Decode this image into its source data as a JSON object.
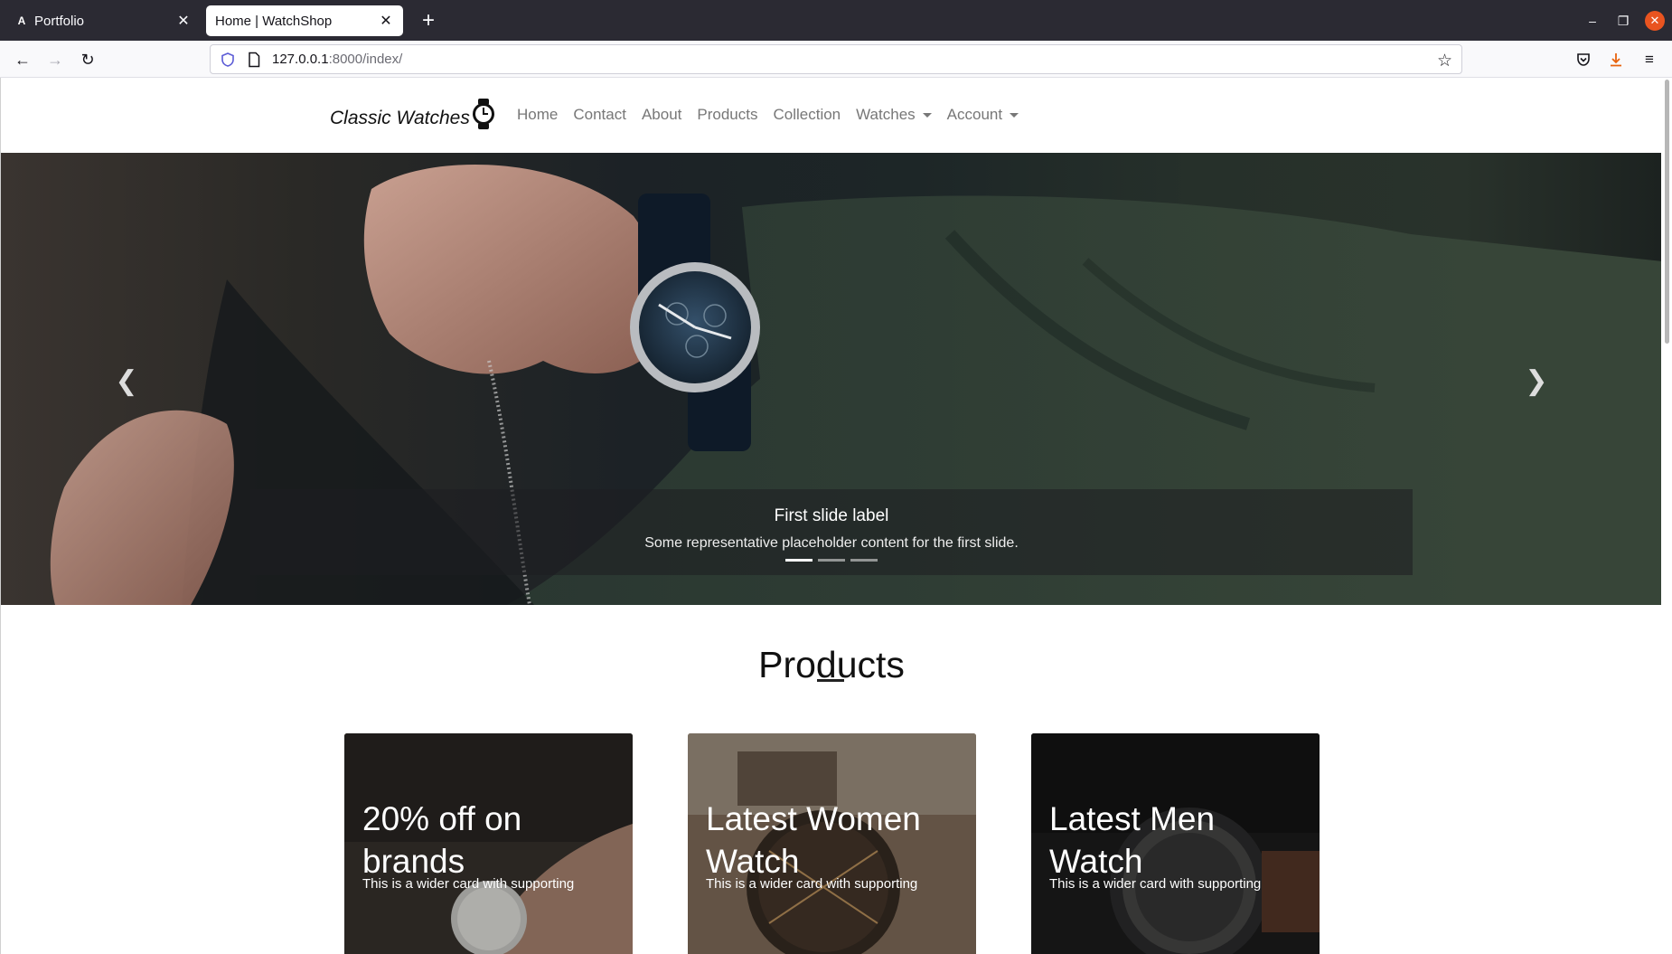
{
  "browser": {
    "tabs": [
      {
        "title": "Portfolio",
        "favicon": "A",
        "active": false
      },
      {
        "title": "Home | WatchShop",
        "active": true
      }
    ],
    "url_host": "127.0.0.1",
    "url_path": ":8000/index/"
  },
  "site": {
    "brand": "Classic Watches",
    "menu": [
      {
        "label": "Home",
        "dropdown": false
      },
      {
        "label": "Contact",
        "dropdown": false
      },
      {
        "label": "About",
        "dropdown": false
      },
      {
        "label": "Products",
        "dropdown": false
      },
      {
        "label": "Collection",
        "dropdown": false
      },
      {
        "label": "Watches",
        "dropdown": true
      },
      {
        "label": "Account",
        "dropdown": true
      }
    ]
  },
  "carousel": {
    "slide_title": "First slide label",
    "slide_text": "Some representative placeholder content for the first slide.",
    "slide_count": 3,
    "active_index": 0
  },
  "products": {
    "heading": "Products",
    "cards": [
      {
        "title": "20% off on brands",
        "text": "This is a wider card with supporting"
      },
      {
        "title": "Latest Women Watch",
        "text": "This is a wider card with supporting"
      },
      {
        "title": "Latest Men Watch",
        "text": "This is a wider card with supporting"
      }
    ]
  }
}
